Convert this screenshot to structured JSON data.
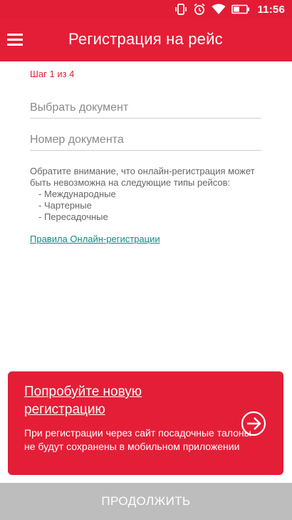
{
  "status_bar": {
    "time": "11:56",
    "icons": [
      "vibrate-icon",
      "alarm-icon",
      "wifi-icon",
      "battery-icon"
    ]
  },
  "app_bar": {
    "menu_icon": "hamburger-menu-icon",
    "title": "Регистрация на рейс"
  },
  "form": {
    "step": "Шаг 1 из 4",
    "document_select": {
      "value": "",
      "placeholder": "Выбрать документ"
    },
    "document_number": {
      "value": "",
      "placeholder": "Номер документа"
    }
  },
  "notice": {
    "text": "Обратите внимание, что онлайн-регистрация может быть невозможна на следующие типы рейсов:",
    "items": [
      "- Международные",
      "- Чартерные",
      "- Пересадочные"
    ],
    "rules_link": "Правила Онлайн-регистрации"
  },
  "promo": {
    "title": "Попробуйте новую регистрацию",
    "text": "При регистрации через сайт посадочные талоны не будут сохранены в мобильном приложении",
    "arrow_icon": "arrow-right-circle-icon"
  },
  "continue_button": {
    "label": "ПРОДОЛЖИТЬ",
    "enabled": false
  },
  "colors": {
    "brand": "#e41e37",
    "link": "#138a84",
    "disabled_button": "#bdbdbd"
  }
}
